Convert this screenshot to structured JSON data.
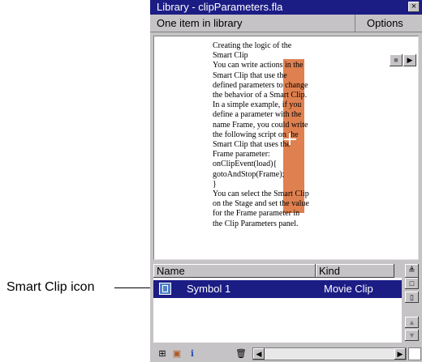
{
  "callout": {
    "label": "Smart Clip icon"
  },
  "window": {
    "title": "Library - clipParameters.fla",
    "close_glyph": "×"
  },
  "infobar": {
    "count_text": "One item in library",
    "options_label": "Options"
  },
  "preview": {
    "lines": [
      "Creating the logic of the",
      "Smart Clip",
      "You can write actions in the",
      "Smart Clip that use the",
      "defined parameters to change",
      "the behavior of a Smart Clip.",
      "In a simple example, if you",
      "define a parameter with the",
      "name Frame, you could write",
      "the following script on the",
      "Smart Clip that uses the",
      "Frame parameter:",
      "onClipEvent(load){",
      "gotoAndStop(Frame);",
      "}",
      "You can select the Smart Clip",
      "on the Stage and set the value",
      "for the Frame parameter in",
      "the Clip Parameters panel."
    ],
    "stop_glyph": "■",
    "play_glyph": "▶"
  },
  "list": {
    "col_name": "Name",
    "col_kind": "Kind",
    "sort_glyph": "≜",
    "rows": [
      {
        "name": "Symbol 1",
        "kind": "Movie Clip",
        "selected": true,
        "icon": "smart-clip-icon"
      }
    ]
  },
  "side_buttons": [
    "□",
    "▯",
    "▲",
    "▼"
  ],
  "bottom": {
    "icons": [
      "new-symbol-icon",
      "new-folder-icon",
      "properties-icon",
      "delete-icon"
    ],
    "icon_glyphs": [
      "⊞",
      "▣",
      "ℹ",
      "🗑"
    ],
    "left_arrow": "◀",
    "right_arrow": "▶"
  },
  "colors": {
    "selection": "#1c1c85",
    "panel": "#c6c3c6",
    "accent": "#d96a31"
  }
}
